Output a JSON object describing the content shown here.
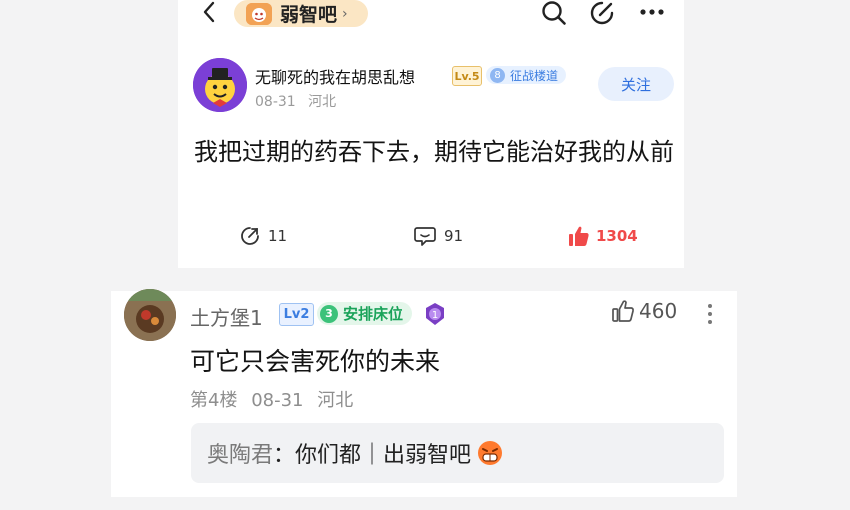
{
  "nav": {
    "back_icon": "chevron-left-icon",
    "forum_name": "弱智吧",
    "forum_chevron": "›",
    "search_icon": "search-icon",
    "edit_icon": "edit-icon",
    "more_icon": "more-horizontal-icon"
  },
  "post": {
    "author": "无聊死的我在胡思乱想",
    "level_badge": "Lv.5",
    "title_number": "8",
    "title_badge": "征战楼道",
    "date": "08-31",
    "location": "河北",
    "follow_label": "关注",
    "text": "我把过期的药吞下去，期待它能治好我的从前",
    "stats": {
      "shares": "11",
      "comments": "91",
      "likes": "1304"
    }
  },
  "comment": {
    "author": "土方堡1",
    "level_badge": "Lv2",
    "title_number": "3",
    "title_badge": "安排床位",
    "medal_number": "1",
    "likes": "460",
    "text": "可它只会害死你的未来",
    "floor": "第4楼",
    "date": "08-31",
    "location": "河北",
    "reply": {
      "author": "奥陶君",
      "text": "：你们都｜出弱智吧"
    }
  },
  "colors": {
    "like_red": "#f04a4a",
    "follow_blue": "#2f6fde",
    "forum_pill": "#fbe6c4",
    "green_title": "#1aa35a"
  }
}
